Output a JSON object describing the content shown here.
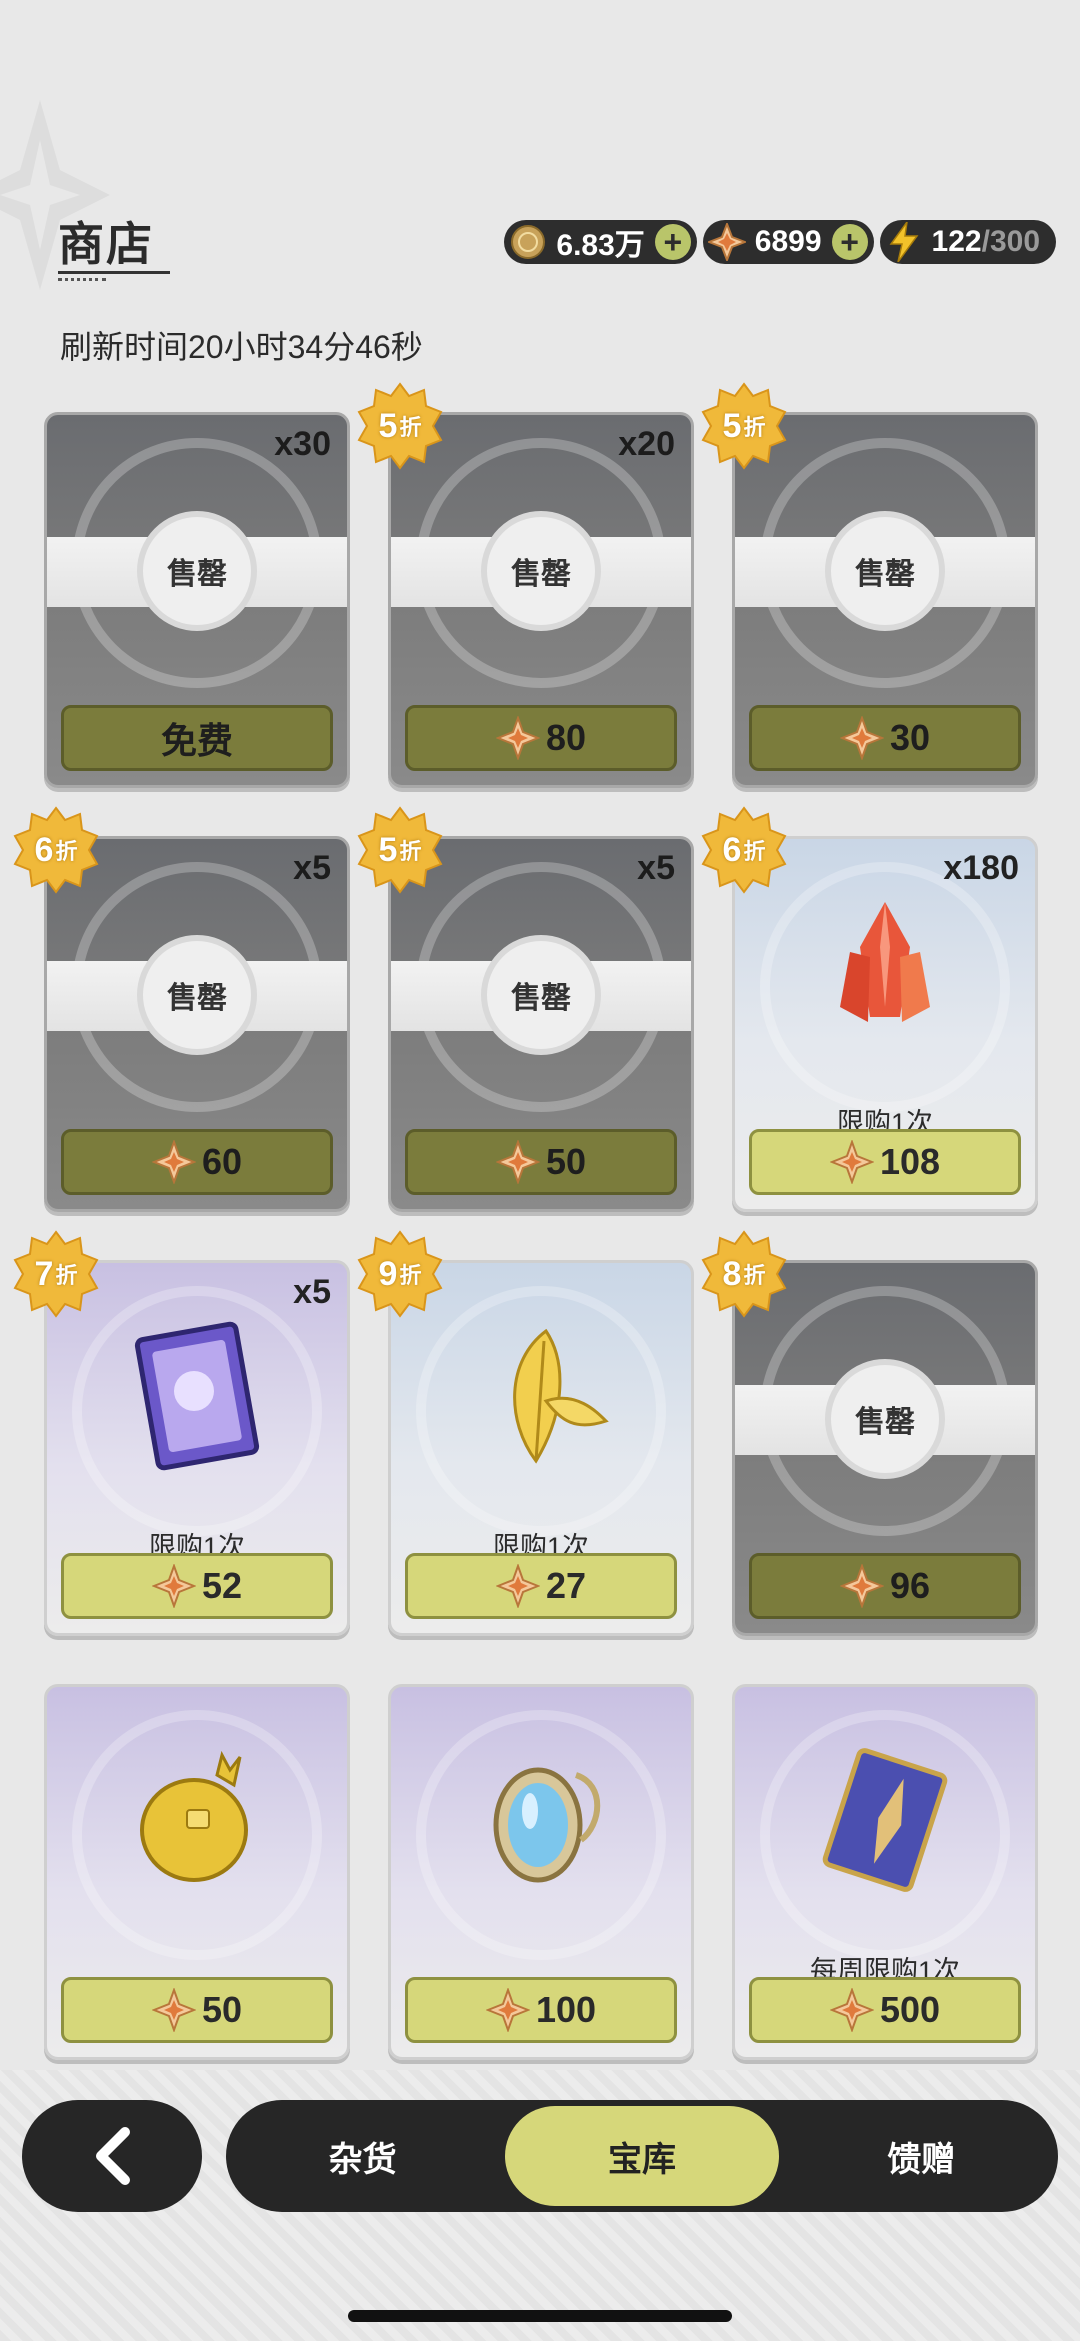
{
  "header": {
    "title": "商店",
    "refresh_text": "刷新时间20小时34分46秒"
  },
  "currencies": {
    "coins": "6.83万",
    "gems": "6899",
    "energy_current": "122",
    "energy_max": "/300",
    "coin_icon": "coin-icon",
    "gem_icon": "gem-icon",
    "energy_icon": "lightning-icon"
  },
  "colors": {
    "accent": "#d6d77a",
    "dark": "#262626",
    "badge": "#f0b93a"
  },
  "cards": [
    {
      "qty": "x30",
      "badge": "",
      "sold": true,
      "sold_label": "售罄",
      "price": "免费",
      "free": true,
      "limit": "",
      "style": "sold",
      "icon": "stick-icon"
    },
    {
      "qty": "x20",
      "badge": "5",
      "sold": true,
      "sold_label": "售罄",
      "price": "80",
      "free": false,
      "limit": "",
      "style": "sold",
      "icon": "card-icon"
    },
    {
      "qty": "",
      "badge": "5",
      "sold": true,
      "sold_label": "售罄",
      "price": "30",
      "free": false,
      "limit": "",
      "style": "sold",
      "icon": "pouch-icon"
    },
    {
      "qty": "x5",
      "badge": "6",
      "sold": true,
      "sold_label": "售罄",
      "price": "60",
      "free": false,
      "limit": "",
      "style": "sold",
      "icon": "ore-icon"
    },
    {
      "qty": "x5",
      "badge": "5",
      "sold": true,
      "sold_label": "售罄",
      "price": "50",
      "free": false,
      "limit": "",
      "style": "sold",
      "icon": "ore-icon"
    },
    {
      "qty": "x180",
      "badge": "6",
      "sold": false,
      "sold_label": "",
      "price": "108",
      "free": false,
      "limit": "限购1次",
      "style": "blue",
      "icon": "crystal-icon"
    },
    {
      "qty": "x5",
      "badge": "7",
      "sold": false,
      "sold_label": "",
      "price": "52",
      "free": false,
      "limit": "限购1次",
      "style": "purple",
      "icon": "character-card-icon"
    },
    {
      "qty": "",
      "badge": "9",
      "sold": false,
      "sold_label": "",
      "price": "27",
      "free": false,
      "limit": "限购1次",
      "style": "blue",
      "icon": "golden-leaf-icon"
    },
    {
      "qty": "",
      "badge": "8",
      "sold": true,
      "sold_label": "售罄",
      "price": "96",
      "free": false,
      "limit": "",
      "style": "sold",
      "icon": "pouch-icon"
    },
    {
      "qty": "",
      "badge": "",
      "sold": false,
      "sold_label": "",
      "price": "50",
      "free": false,
      "limit": "",
      "style": "purple",
      "icon": "golden-orb-icon"
    },
    {
      "qty": "",
      "badge": "",
      "sold": false,
      "sold_label": "",
      "price": "100",
      "free": false,
      "limit": "",
      "style": "purple",
      "icon": "mirror-icon"
    },
    {
      "qty": "",
      "badge": "",
      "sold": false,
      "sold_label": "",
      "price": "500",
      "free": false,
      "limit": "每周限购1次",
      "style": "purple",
      "icon": "feather-card-icon"
    }
  ],
  "badge_suffix": "折",
  "nav": {
    "back_icon": "back-arrow-icon",
    "tabs": [
      {
        "label": "杂货",
        "active": false
      },
      {
        "label": "宝库",
        "active": true
      },
      {
        "label": "馈赠",
        "active": false
      }
    ]
  }
}
